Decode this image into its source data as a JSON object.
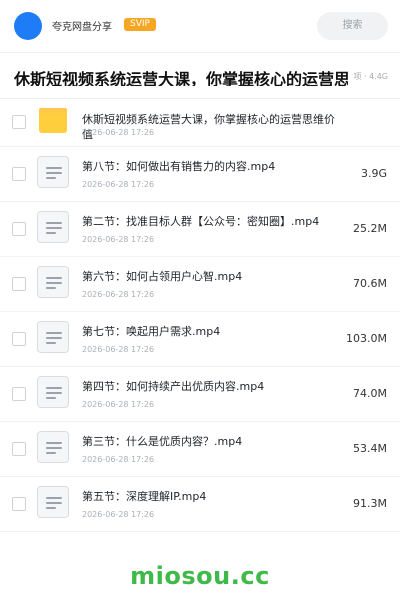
{
  "header": {
    "username": "夸克网盘分享",
    "vip_badge": "SVIP",
    "search_placeholder": "搜索",
    "avatar_color": "#1e7cf7"
  },
  "folder": {
    "title": "休斯短视频系统运营大课，你掌握核心的运营思维",
    "meta": "项 · 4.4G"
  },
  "items": [
    {
      "type": "folder",
      "name": "休斯短视频系统运营大课，你掌握核心的运营思维价值",
      "date": "2026-06-28 17:26",
      "size": ""
    },
    {
      "type": "file",
      "name": "第八节：如何做出有销售力的内容.mp4",
      "date": "2026-06-28 17:26",
      "size": "3.9G"
    },
    {
      "type": "file",
      "name": "第二节：找准目标人群【公众号：密知圈】.mp4",
      "date": "2026-06-28 17:26",
      "size": "25.2M"
    },
    {
      "type": "file",
      "name": "第六节：如何占领用户心智.mp4",
      "date": "2026-06-28 17:26",
      "size": "70.6M"
    },
    {
      "type": "file",
      "name": "第七节：唤起用户需求.mp4",
      "date": "2026-06-28 17:26",
      "size": "103.0M"
    },
    {
      "type": "file",
      "name": "第四节：如何持续产出优质内容.mp4",
      "date": "2026-06-28 17:26",
      "size": "74.0M"
    },
    {
      "type": "file",
      "name": "第三节：什么是优质内容？.mp4",
      "date": "2026-06-28 17:26",
      "size": "53.4M"
    },
    {
      "type": "file",
      "name": "第五节：深度理解IP.mp4",
      "date": "2026-06-28 17:26",
      "size": "91.3M"
    }
  ],
  "watermark": "miosou.cc",
  "colors": {
    "accent": "#1e7cf7",
    "vip": "#f5a623",
    "watermark": "#3fb948",
    "folder": "#ffce3d"
  }
}
